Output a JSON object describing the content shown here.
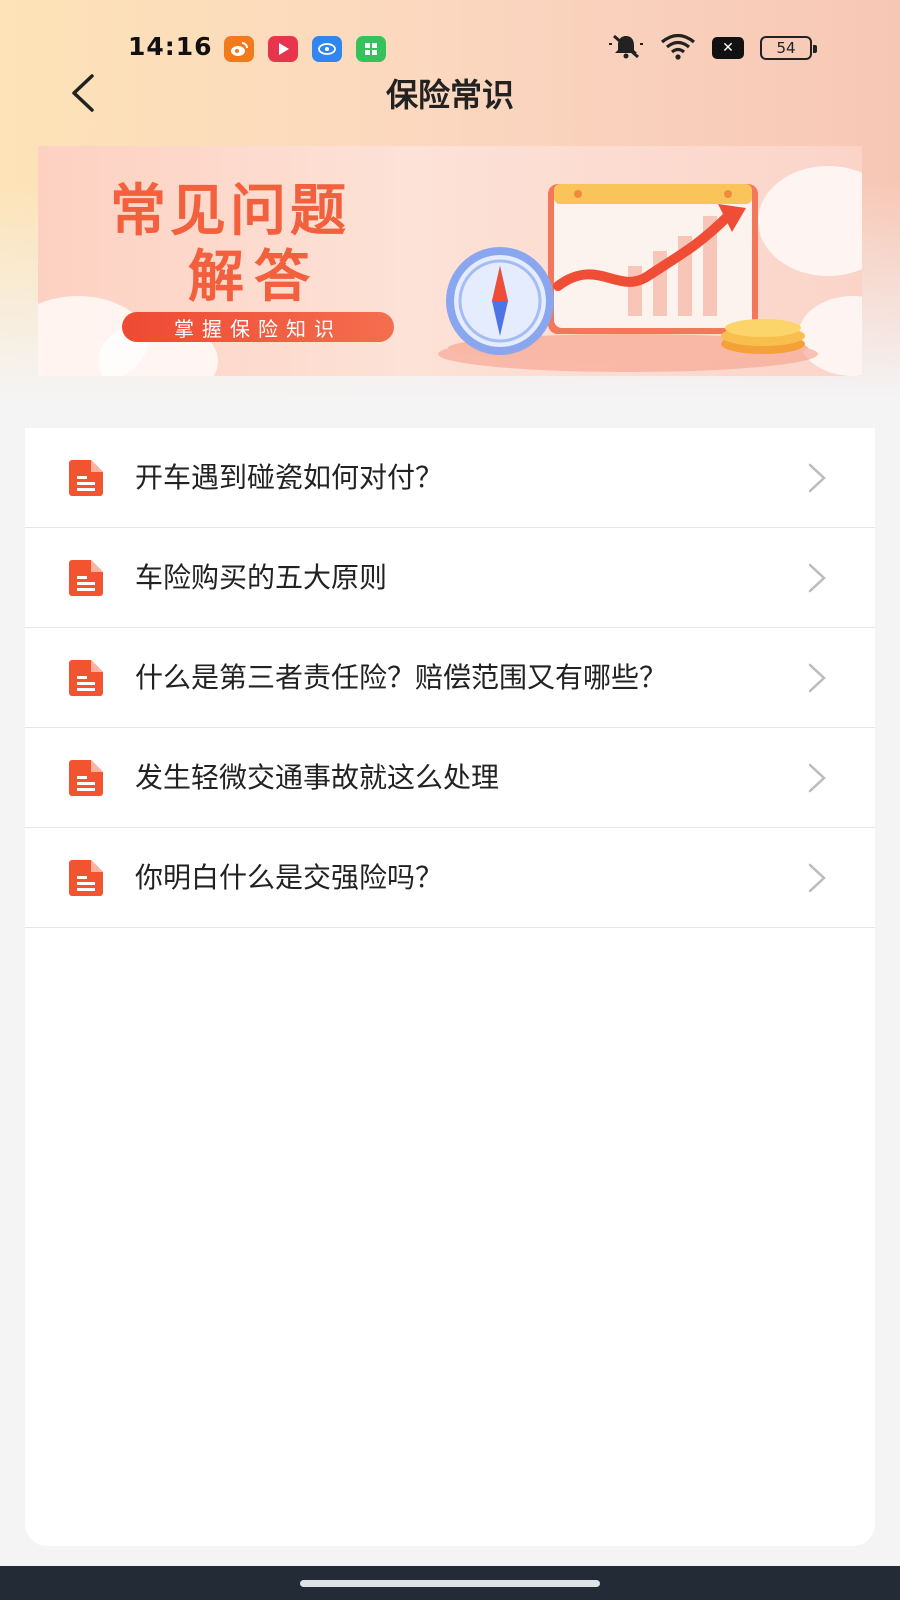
{
  "status_bar": {
    "time": "14:16",
    "battery": "54",
    "x_label": "✕",
    "icons": [
      "weibo-icon",
      "video-icon",
      "browser-icon",
      "store-icon",
      "mute-icon",
      "wifi-icon"
    ]
  },
  "header": {
    "title": "保险常识",
    "back_icon": "back-arrow-icon"
  },
  "banner": {
    "title_line1": "常见问题",
    "title_line2": "解答",
    "pill": "掌握保险知识"
  },
  "colors": {
    "accent": "#f2603e",
    "icon": "#f1542f",
    "chevron": "#bbbbbb"
  },
  "list": [
    {
      "label": "开车遇到碰瓷如何对付？"
    },
    {
      "label": "车险购买的五大原则"
    },
    {
      "label": "什么是第三者责任险？赔偿范围又有哪些？"
    },
    {
      "label": "发生轻微交通事故就这么处理"
    },
    {
      "label": "你明白什么是交强险吗？"
    }
  ]
}
